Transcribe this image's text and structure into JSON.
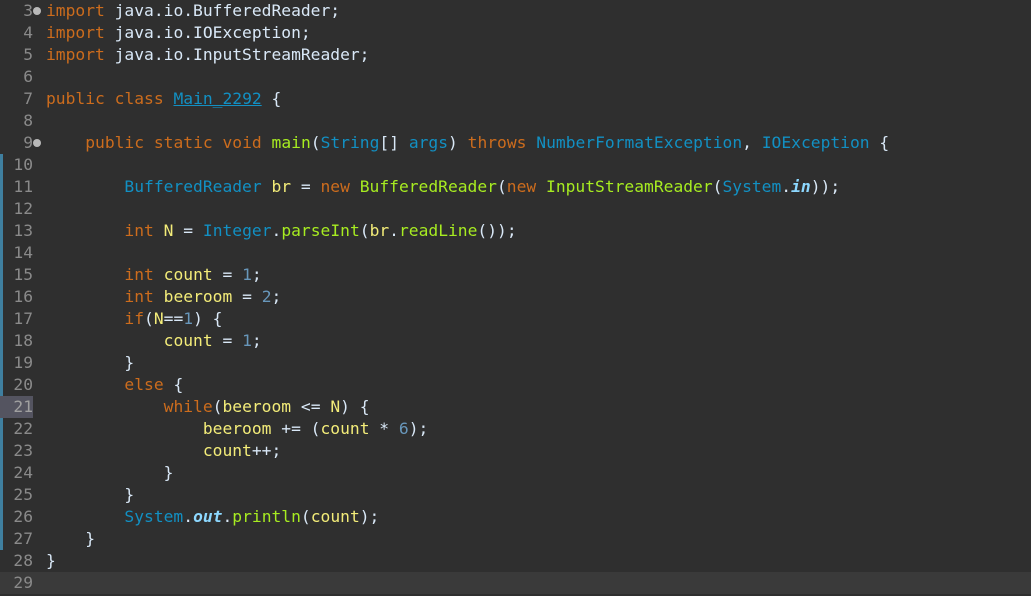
{
  "lines": [
    {
      "n": "3",
      "code": [
        [
          "kw",
          "import"
        ],
        [
          "plain",
          " java.io.BufferedReader;"
        ]
      ]
    },
    {
      "n": "4",
      "code": [
        [
          "kw",
          "import"
        ],
        [
          "plain",
          " java.io.IOException;"
        ]
      ]
    },
    {
      "n": "5",
      "code": [
        [
          "kw",
          "import"
        ],
        [
          "plain",
          " java.io.InputStreamReader;"
        ]
      ]
    },
    {
      "n": "6",
      "code": []
    },
    {
      "n": "7",
      "code": [
        [
          "kw",
          "public"
        ],
        [
          "plain",
          " "
        ],
        [
          "kw",
          "class"
        ],
        [
          "plain",
          " "
        ],
        [
          "cls",
          "Main_2292"
        ],
        [
          "plain",
          " {"
        ]
      ]
    },
    {
      "n": "8",
      "code": []
    },
    {
      "n": "9",
      "code": [
        [
          "plain",
          "    "
        ],
        [
          "kw",
          "public"
        ],
        [
          "plain",
          " "
        ],
        [
          "kw",
          "static"
        ],
        [
          "plain",
          " "
        ],
        [
          "kw",
          "void"
        ],
        [
          "plain",
          " "
        ],
        [
          "fn",
          "main"
        ],
        [
          "plain",
          "("
        ],
        [
          "tp",
          "String"
        ],
        [
          "plain",
          "[] "
        ],
        [
          "ty",
          "args"
        ],
        [
          "plain",
          ") "
        ],
        [
          "kw",
          "throws"
        ],
        [
          "plain",
          " "
        ],
        [
          "tp",
          "NumberFormatException"
        ],
        [
          "plain",
          ", "
        ],
        [
          "tp",
          "IOException"
        ],
        [
          "plain",
          " {"
        ]
      ]
    },
    {
      "n": "10",
      "code": []
    },
    {
      "n": "11",
      "code": [
        [
          "plain",
          "        "
        ],
        [
          "tp",
          "BufferedReader"
        ],
        [
          "plain",
          " "
        ],
        [
          "var",
          "br"
        ],
        [
          "plain",
          " = "
        ],
        [
          "kw",
          "new"
        ],
        [
          "plain",
          " "
        ],
        [
          "fn",
          "BufferedReader"
        ],
        [
          "plain",
          "("
        ],
        [
          "kw",
          "new"
        ],
        [
          "plain",
          " "
        ],
        [
          "fn",
          "InputStreamReader"
        ],
        [
          "plain",
          "("
        ],
        [
          "tp",
          "System"
        ],
        [
          "plain",
          "."
        ],
        [
          "stb",
          "in"
        ],
        [
          "plain",
          "));"
        ]
      ]
    },
    {
      "n": "12",
      "code": []
    },
    {
      "n": "13",
      "code": [
        [
          "plain",
          "        "
        ],
        [
          "kw",
          "int"
        ],
        [
          "plain",
          " "
        ],
        [
          "var",
          "N"
        ],
        [
          "plain",
          " = "
        ],
        [
          "tp",
          "Integer"
        ],
        [
          "plain",
          "."
        ],
        [
          "fn",
          "parseInt"
        ],
        [
          "plain",
          "("
        ],
        [
          "var",
          "br"
        ],
        [
          "plain",
          "."
        ],
        [
          "fn",
          "readLine"
        ],
        [
          "plain",
          "());"
        ]
      ]
    },
    {
      "n": "14",
      "code": []
    },
    {
      "n": "15",
      "code": [
        [
          "plain",
          "        "
        ],
        [
          "kw",
          "int"
        ],
        [
          "plain",
          " "
        ],
        [
          "var",
          "count"
        ],
        [
          "plain",
          " = "
        ],
        [
          "num",
          "1"
        ],
        [
          "plain",
          ";"
        ]
      ]
    },
    {
      "n": "16",
      "code": [
        [
          "plain",
          "        "
        ],
        [
          "kw",
          "int"
        ],
        [
          "plain",
          " "
        ],
        [
          "var",
          "beeroom"
        ],
        [
          "plain",
          " = "
        ],
        [
          "num",
          "2"
        ],
        [
          "plain",
          ";"
        ]
      ]
    },
    {
      "n": "17",
      "code": [
        [
          "plain",
          "        "
        ],
        [
          "kw",
          "if"
        ],
        [
          "plain",
          "("
        ],
        [
          "var",
          "N"
        ],
        [
          "plain",
          "=="
        ],
        [
          "num",
          "1"
        ],
        [
          "plain",
          ") {"
        ]
      ]
    },
    {
      "n": "18",
      "code": [
        [
          "plain",
          "            "
        ],
        [
          "var",
          "count"
        ],
        [
          "plain",
          " = "
        ],
        [
          "num",
          "1"
        ],
        [
          "plain",
          ";"
        ]
      ]
    },
    {
      "n": "19",
      "code": [
        [
          "plain",
          "        }"
        ]
      ]
    },
    {
      "n": "20",
      "code": [
        [
          "plain",
          "        "
        ],
        [
          "kw",
          "else"
        ],
        [
          "plain",
          " {"
        ]
      ]
    },
    {
      "n": "21",
      "code": [
        [
          "plain",
          "            "
        ],
        [
          "kw",
          "while"
        ],
        [
          "plain",
          "("
        ],
        [
          "var",
          "beeroom"
        ],
        [
          "plain",
          " <= "
        ],
        [
          "var",
          "N"
        ],
        [
          "plain",
          ") {"
        ]
      ]
    },
    {
      "n": "22",
      "code": [
        [
          "plain",
          "                "
        ],
        [
          "var",
          "beeroom"
        ],
        [
          "plain",
          " += ("
        ],
        [
          "var",
          "count"
        ],
        [
          "plain",
          " * "
        ],
        [
          "num",
          "6"
        ],
        [
          "plain",
          ");"
        ]
      ]
    },
    {
      "n": "23",
      "code": [
        [
          "plain",
          "                "
        ],
        [
          "var",
          "count"
        ],
        [
          "plain",
          "++;"
        ]
      ]
    },
    {
      "n": "24",
      "code": [
        [
          "plain",
          "            }"
        ]
      ]
    },
    {
      "n": "25",
      "code": [
        [
          "plain",
          "        }"
        ]
      ]
    },
    {
      "n": "26",
      "code": [
        [
          "plain",
          "        "
        ],
        [
          "tp",
          "System"
        ],
        [
          "plain",
          "."
        ],
        [
          "stb",
          "out"
        ],
        [
          "plain",
          "."
        ],
        [
          "fn",
          "println"
        ],
        [
          "plain",
          "("
        ],
        [
          "var",
          "count"
        ],
        [
          "plain",
          ");"
        ]
      ]
    },
    {
      "n": "27",
      "code": [
        [
          "plain",
          "    }"
        ]
      ]
    },
    {
      "n": "28",
      "code": [
        [
          "plain",
          "}"
        ]
      ]
    },
    {
      "n": "29",
      "code": []
    }
  ],
  "colors": {
    "background": "#2f2f2f",
    "keyword": "#cc6c1d",
    "type": "#1290c3",
    "variable": "#f3ec79",
    "method": "#a7ec21",
    "number": "#6897bb",
    "text": "#d9e8f7"
  }
}
